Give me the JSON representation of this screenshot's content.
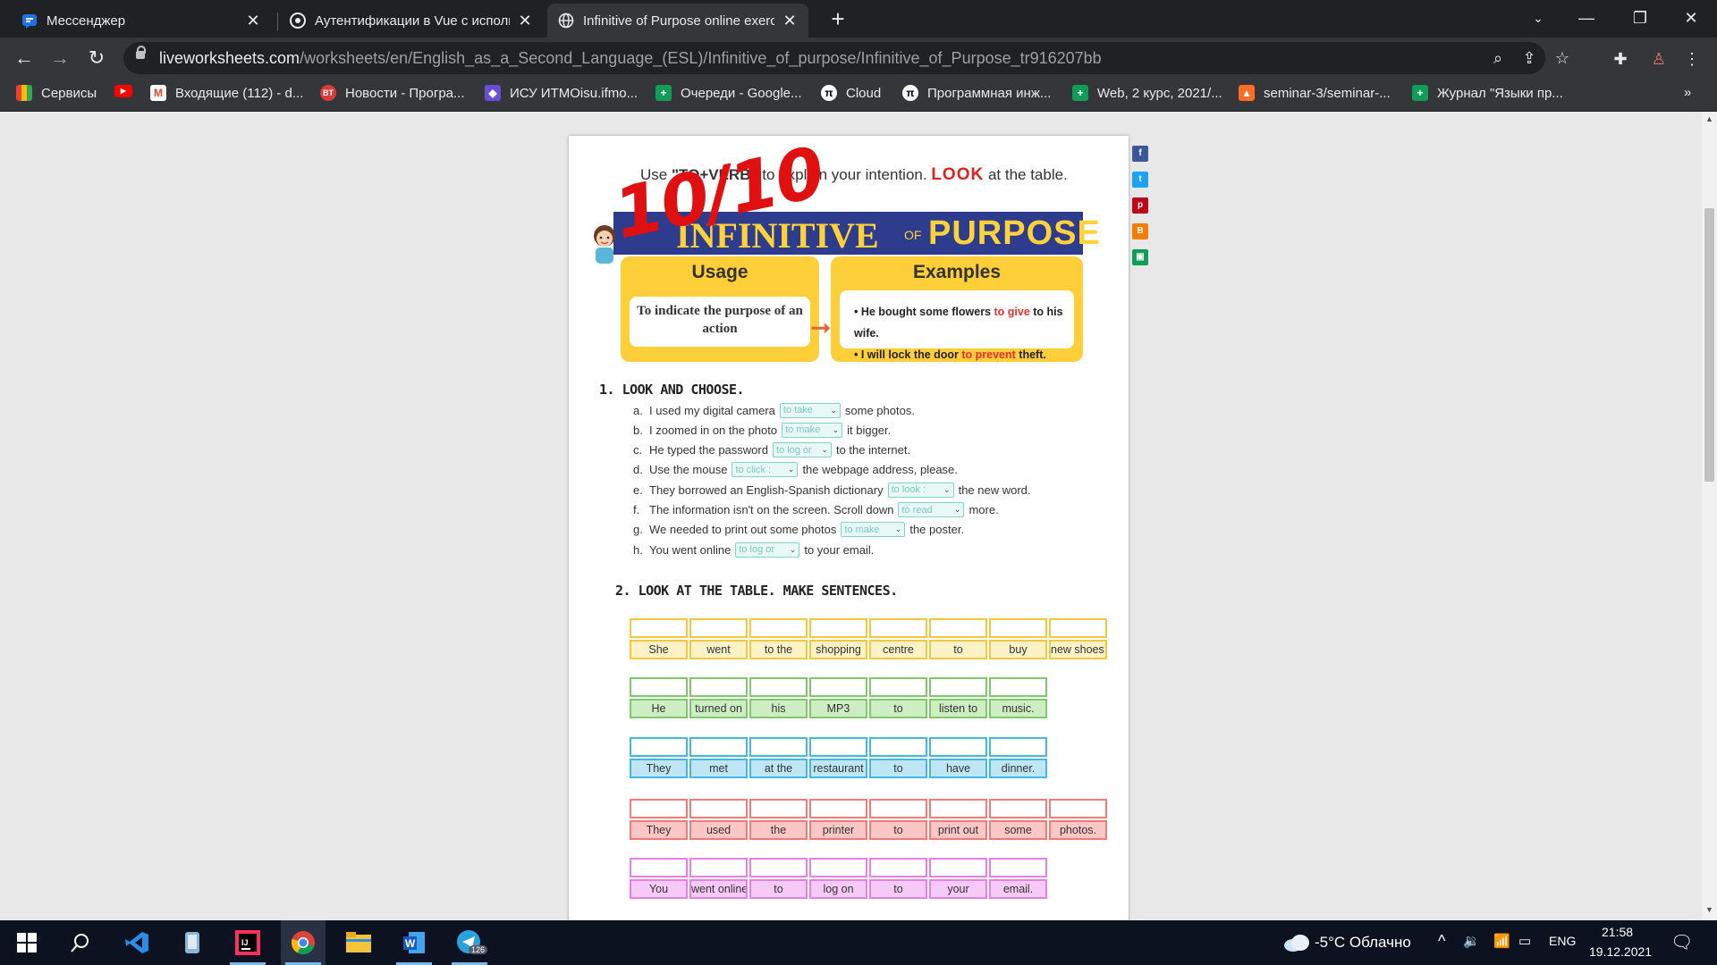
{
  "browser": {
    "tabs": [
      {
        "title": "Мессенджер",
        "icon": "messenger-icon"
      },
      {
        "title": "Аутентификации в Vue с исполь",
        "icon": "chrome-web-icon"
      },
      {
        "title": "Infinitive of Purpose online exerc",
        "icon": "globe-icon"
      }
    ],
    "new_tab": "+",
    "url_host": "liveworksheets.com",
    "url_path": "/worksheets/en/English_as_a_Second_Language_(ESL)/Infinitive_of_purpose/Infinitive_of_Purpose_tr916207bb",
    "bookmarks": [
      {
        "label": "Сервисы",
        "icon": "apps-grid-icon"
      },
      {
        "label": "",
        "icon": "youtube-icon"
      },
      {
        "label": "Входящие (112) - d...",
        "icon": "gmail-icon"
      },
      {
        "label": "Новости - Програ...",
        "icon": "bt-icon"
      },
      {
        "label": "ИСУ ИТМОisu.ifmo...",
        "icon": "itmo-icon"
      },
      {
        "label": "Очереди - Google...",
        "icon": "sheets-icon"
      },
      {
        "label": "Cloud",
        "icon": "pi-icon"
      },
      {
        "label": "Программная инж...",
        "icon": "pi-icon"
      },
      {
        "label": "Web, 2 курс, 2021/...",
        "icon": "sheets-icon"
      },
      {
        "label": "seminar-3/seminar-...",
        "icon": "gitlab-icon"
      },
      {
        "label": "Журнал \"Языки пр...",
        "icon": "sheets-icon"
      }
    ],
    "bookmarks_more": "»"
  },
  "worksheet": {
    "intro_before": "Use",
    "intro_formula": "\"TO+VERB\"",
    "intro_mid": "to explain your intention.",
    "intro_look": "LOOK",
    "intro_after": "at the table.",
    "score": "10/10",
    "banner_left": "INFINITIVE",
    "banner_of": "OF",
    "banner_right": "PURPOSE",
    "usage_title": "Usage",
    "usage_text": "To indicate the purpose of an action",
    "examples_title": "Examples",
    "examples": [
      {
        "before": "He bought some flowers ",
        "red": "to give",
        "after": " to his wife."
      },
      {
        "before": "I will lock the door ",
        "red": "to prevent",
        "after": " theft."
      }
    ],
    "section1_title": "1. LOOK AND CHOOSE.",
    "section1_items": [
      {
        "letter": "a.",
        "before": "I used my digital camera",
        "choice": "to take",
        "after": "some photos."
      },
      {
        "letter": "b.",
        "before": "I zoomed in on the photo",
        "choice": "to make",
        "after": "it bigger."
      },
      {
        "letter": "c.",
        "before": "He typed the password",
        "choice": "to log or",
        "after": "to the internet."
      },
      {
        "letter": "d.",
        "before": "Use the mouse",
        "choice": "to click :",
        "after": "the webpage address, please."
      },
      {
        "letter": "e.",
        "before": "They borrowed an English-Spanish dictionary",
        "choice": "to look :",
        "after": "the new word."
      },
      {
        "letter": "f.",
        "before": "The information isn't on the screen. Scroll down",
        "choice": "to read",
        "after": "more."
      },
      {
        "letter": "g.",
        "before": "We needed to print out some photos",
        "choice": "to make",
        "after": "the poster."
      },
      {
        "letter": "h.",
        "before": "You went online",
        "choice": "to log or",
        "after": "to your email."
      }
    ],
    "section2_title": "2. LOOK AT THE TABLE. MAKE SENTENCES.",
    "sentence_rows": [
      {
        "words": [
          "She",
          "went",
          "to the",
          "shopping",
          "centre",
          "to",
          "buy",
          "new shoes."
        ],
        "border": "#f2c93c",
        "fill": "#fbf3c6"
      },
      {
        "words": [
          "He",
          "turned on",
          "his",
          "MP3",
          "to",
          "listen to",
          "music."
        ],
        "border": "#7fc96a",
        "fill": "#cdeec2"
      },
      {
        "words": [
          "They",
          "met",
          "at the",
          "restaurant",
          "to",
          "have",
          "dinner."
        ],
        "border": "#45b8e0",
        "fill": "#bfe6f4"
      },
      {
        "words": [
          "They",
          "used",
          "the",
          "printer",
          "to",
          "print out",
          "some",
          "photos."
        ],
        "border": "#ef7b7b",
        "fill": "#fbc6c6"
      },
      {
        "words": [
          "You",
          "went online",
          "to",
          "log on",
          "to",
          "your",
          "email."
        ],
        "border": "#e67fe6",
        "fill": "#f7c9f7"
      }
    ]
  },
  "taskbar": {
    "weather": "-5°C  Облачно",
    "language": "ENG",
    "time": "21:58",
    "date": "19.12.2021",
    "telegram_badge": "126"
  }
}
